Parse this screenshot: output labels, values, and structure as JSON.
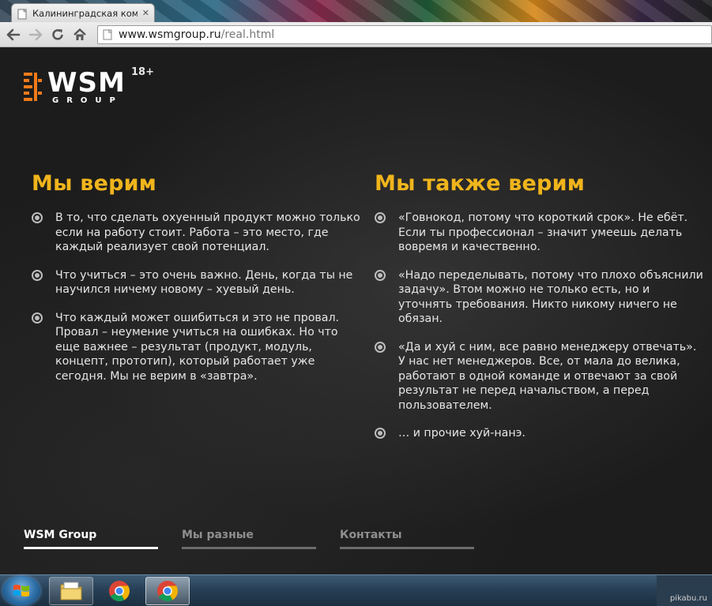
{
  "browser": {
    "tab_title": "Калининградская компа",
    "tab_close": "✕",
    "url_host": "www.wsmgroup.ru",
    "url_path": "/real.html"
  },
  "header": {
    "logo_text": "WSM",
    "logo_sub": "GROUP",
    "age_rating": "18+"
  },
  "left": {
    "heading": "Мы верим",
    "items": [
      "В то, что сделать охуенный продукт можно только если на работу стоит. Работа – это место, где каждый реализует свой потенциал.",
      "Что учиться – это очень важно. День, когда ты не научился ничему новому – хуевый день.",
      "Что каждый может ошибиться и это не провал. Провал – неумение учиться на ошибках. Но что еще важнее – результат (продукт, модуль, концепт, прототип), который работает уже сегодня. Мы не верим в «завтра»."
    ]
  },
  "right": {
    "heading": "Мы также верим",
    "items": [
      "«Говнокод, потому что короткий срок». Не ебёт. Если ты профессионал – значит умеешь делать вовремя и качественно.",
      "«Надо переделывать, потому что плохо объяснили задачу». Втом можно не только есть, но и уточнять требования. Никто никому ничего не обязан.",
      "«Да и хуй с ним, все равно менеджеру отвечать». У нас нет менеджеров. Все, от мала до велика, работают в одной команде и отвечают за свой результат не перед начальством, а перед пользователем.",
      "… и прочие хуй-нанэ."
    ]
  },
  "footer_nav": [
    {
      "label": "WSM Group",
      "active": true
    },
    {
      "label": "Мы разные",
      "active": false
    },
    {
      "label": "Контакты",
      "active": false
    }
  ],
  "watermark": "pikabu.ru",
  "colors": {
    "accent": "#f0b51c",
    "logo_orange": "#f07a1a",
    "text": "#e6e6e6",
    "background": "#1c1c1c"
  }
}
